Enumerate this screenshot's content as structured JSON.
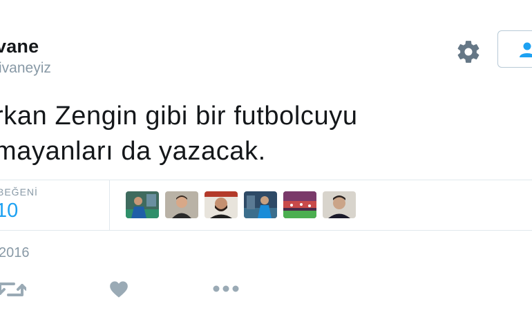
{
  "tweet": {
    "display_name": "vane",
    "username": "ivaneyiz",
    "text_lines": [
      "rkan Zengin gibi bir futbolcuyu",
      "mayanları da yazacak."
    ],
    "date": "2016"
  },
  "stats": {
    "likes_label": "BEĞENİ",
    "likes_count": "10"
  },
  "colors": {
    "text": "#14171a",
    "muted": "#8899a6",
    "accent": "#1da1f2",
    "divider": "#e1e8ed"
  },
  "icons": {
    "settings": "gear-icon",
    "follow": "follow-user-icon",
    "retweet": "retweet-icon",
    "like": "heart-icon",
    "more": "more-dots-icon"
  },
  "likers": [
    {
      "name": "liker-avatar-1"
    },
    {
      "name": "liker-avatar-2"
    },
    {
      "name": "liker-avatar-3"
    },
    {
      "name": "liker-avatar-4"
    },
    {
      "name": "liker-avatar-5"
    },
    {
      "name": "liker-avatar-6"
    }
  ]
}
